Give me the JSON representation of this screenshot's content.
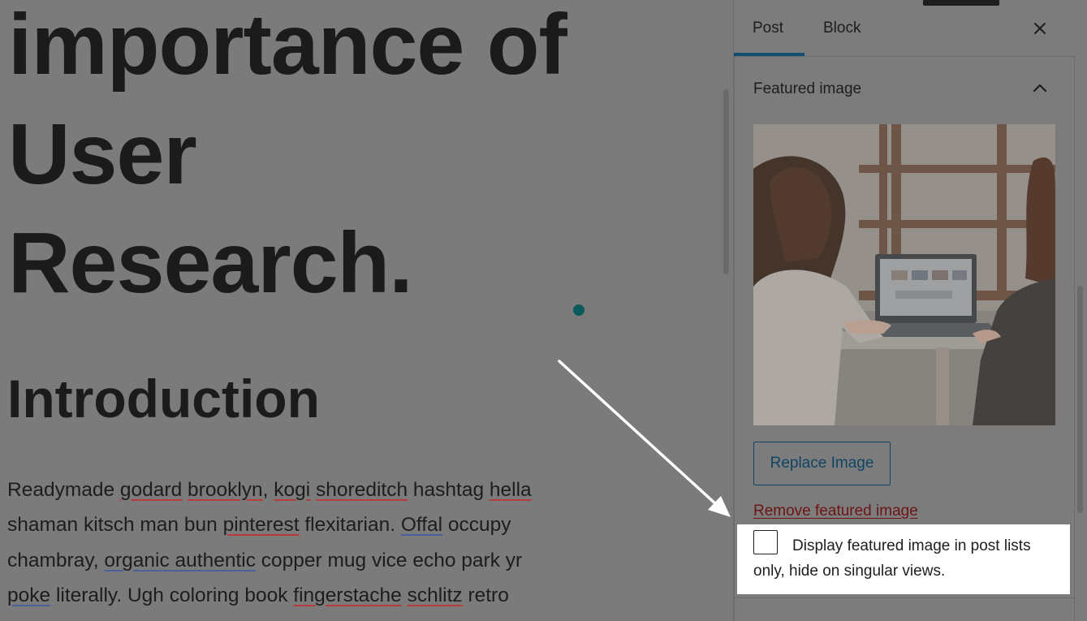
{
  "editor": {
    "title_lines": [
      "importance of",
      "User",
      "Research."
    ],
    "heading": "Introduction",
    "paragraph_lines": [
      [
        {
          "t": "Readymade ",
          "u": ""
        },
        {
          "t": "godard",
          "u": "red"
        },
        {
          "t": " ",
          "u": ""
        },
        {
          "t": "brooklyn",
          "u": "red"
        },
        {
          "t": ", ",
          "u": ""
        },
        {
          "t": "kogi",
          "u": "red"
        },
        {
          "t": " ",
          "u": ""
        },
        {
          "t": "shoreditch",
          "u": "red"
        },
        {
          "t": " hashtag ",
          "u": ""
        },
        {
          "t": "hella",
          "u": "red"
        }
      ],
      [
        {
          "t": "shaman kitsch man bun ",
          "u": ""
        },
        {
          "t": "pinterest",
          "u": "red"
        },
        {
          "t": " flexitarian. ",
          "u": ""
        },
        {
          "t": "Offal",
          "u": "blue"
        },
        {
          "t": " occupy",
          "u": ""
        }
      ],
      [
        {
          "t": "chambray, ",
          "u": ""
        },
        {
          "t": "organic authentic",
          "u": "blue"
        },
        {
          "t": " copper mug vice echo park yr",
          "u": ""
        }
      ],
      [
        {
          "t": "poke",
          "u": "blue"
        },
        {
          "t": " literally. Ugh coloring book ",
          "u": ""
        },
        {
          "t": "fingerstache",
          "u": "red"
        },
        {
          "t": " ",
          "u": ""
        },
        {
          "t": "schlitz",
          "u": "red"
        },
        {
          "t": " retro",
          "u": ""
        }
      ]
    ]
  },
  "sidebar": {
    "tabs": [
      {
        "label": "Post"
      },
      {
        "label": "Block"
      }
    ],
    "active_tab": "Post",
    "close_icon": "close-icon",
    "panel": {
      "title": "Featured image",
      "toggle_icon": "chevron-up-icon",
      "image_alt": "Two women working at a laptop in front of a window",
      "replace_label": "Replace Image",
      "remove_label": "Remove featured image",
      "checkbox_label": "Display featured image in post lists only, hide on singular views.",
      "checkbox_checked": false
    }
  },
  "colors": {
    "overlay": "#7b7b7b",
    "accent": "#124f6e",
    "danger_link": "#6e1414",
    "highlight": "#ffffff"
  }
}
